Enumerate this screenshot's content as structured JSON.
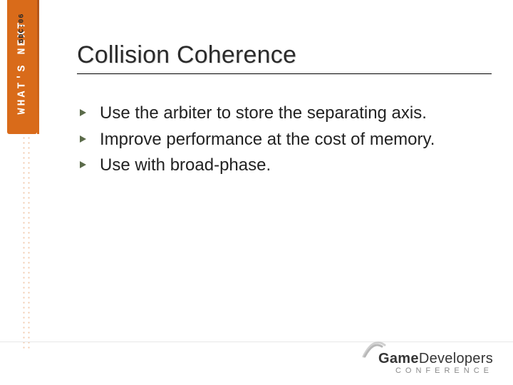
{
  "banner": {
    "top_label": "GDC:06",
    "main_label": "WHAT'S NEXT"
  },
  "slide": {
    "title": "Collision Coherence",
    "bullets": [
      "Use the arbiter to store the separating axis.",
      "Improve performance at the cost of memory.",
      "Use with broad-phase."
    ]
  },
  "footer": {
    "brand_bold": "Game",
    "brand_rest": "Developers",
    "subline": "CONFERENCE"
  }
}
